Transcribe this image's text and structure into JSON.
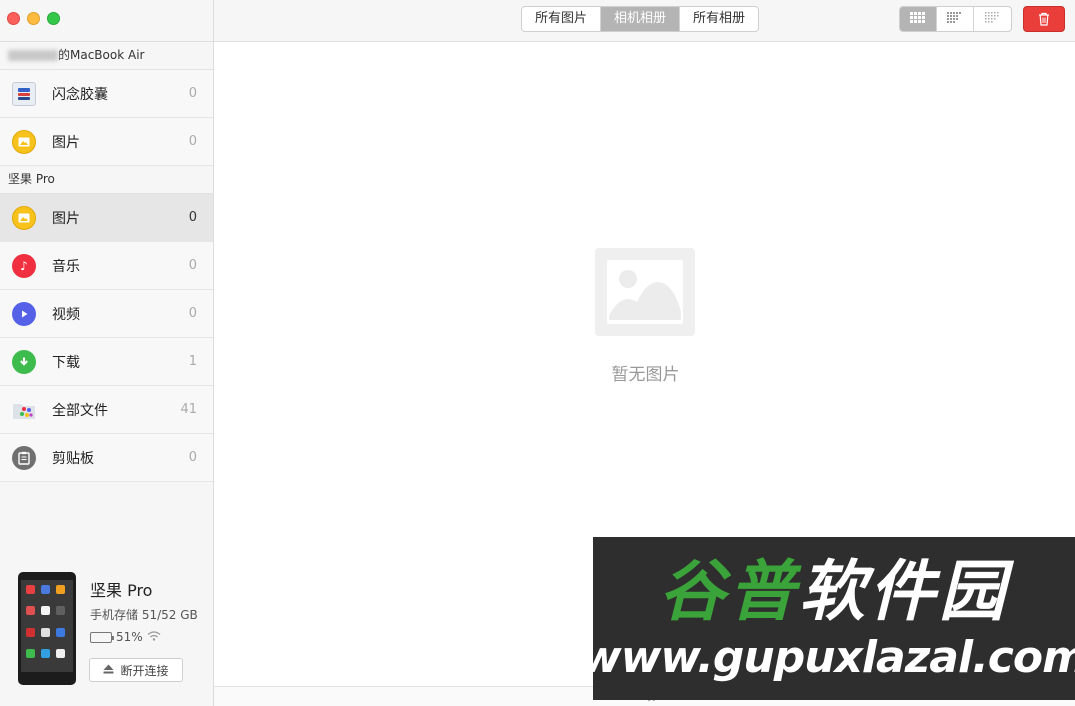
{
  "sidebar": {
    "mac_section": "的MacBook Air",
    "mac_items": [
      {
        "label": "闪念胶囊",
        "count": "0",
        "icon": "flash-capsule-icon"
      },
      {
        "label": "图片",
        "count": "0",
        "icon": "picture-icon"
      }
    ],
    "device_section": "坚果 Pro",
    "device_items": [
      {
        "label": "图片",
        "count": "0",
        "icon": "picture-icon"
      },
      {
        "label": "音乐",
        "count": "0",
        "icon": "music-icon"
      },
      {
        "label": "视频",
        "count": "0",
        "icon": "video-icon"
      },
      {
        "label": "下载",
        "count": "1",
        "icon": "download-icon"
      },
      {
        "label": "全部文件",
        "count": "41",
        "icon": "files-icon"
      },
      {
        "label": "剪贴板",
        "count": "0",
        "icon": "clipboard-icon"
      }
    ]
  },
  "device": {
    "name": "坚果 Pro",
    "storage": "手机存储 51/52 GB",
    "battery": "51%",
    "battery_level": 0.51,
    "disconnect_label": "断开连接"
  },
  "toolbar": {
    "tabs": [
      "所有图片",
      "相机相册",
      "所有相册"
    ],
    "active_tab": "相机相册"
  },
  "main": {
    "empty_text": "暂无图片",
    "status": "0 项"
  },
  "watermark": {
    "cn": "谷普软件园",
    "url": "www.gupuxlazal.com"
  },
  "colors": {
    "delete": "#e93e3a",
    "active_segment": "#b4b4b4"
  }
}
